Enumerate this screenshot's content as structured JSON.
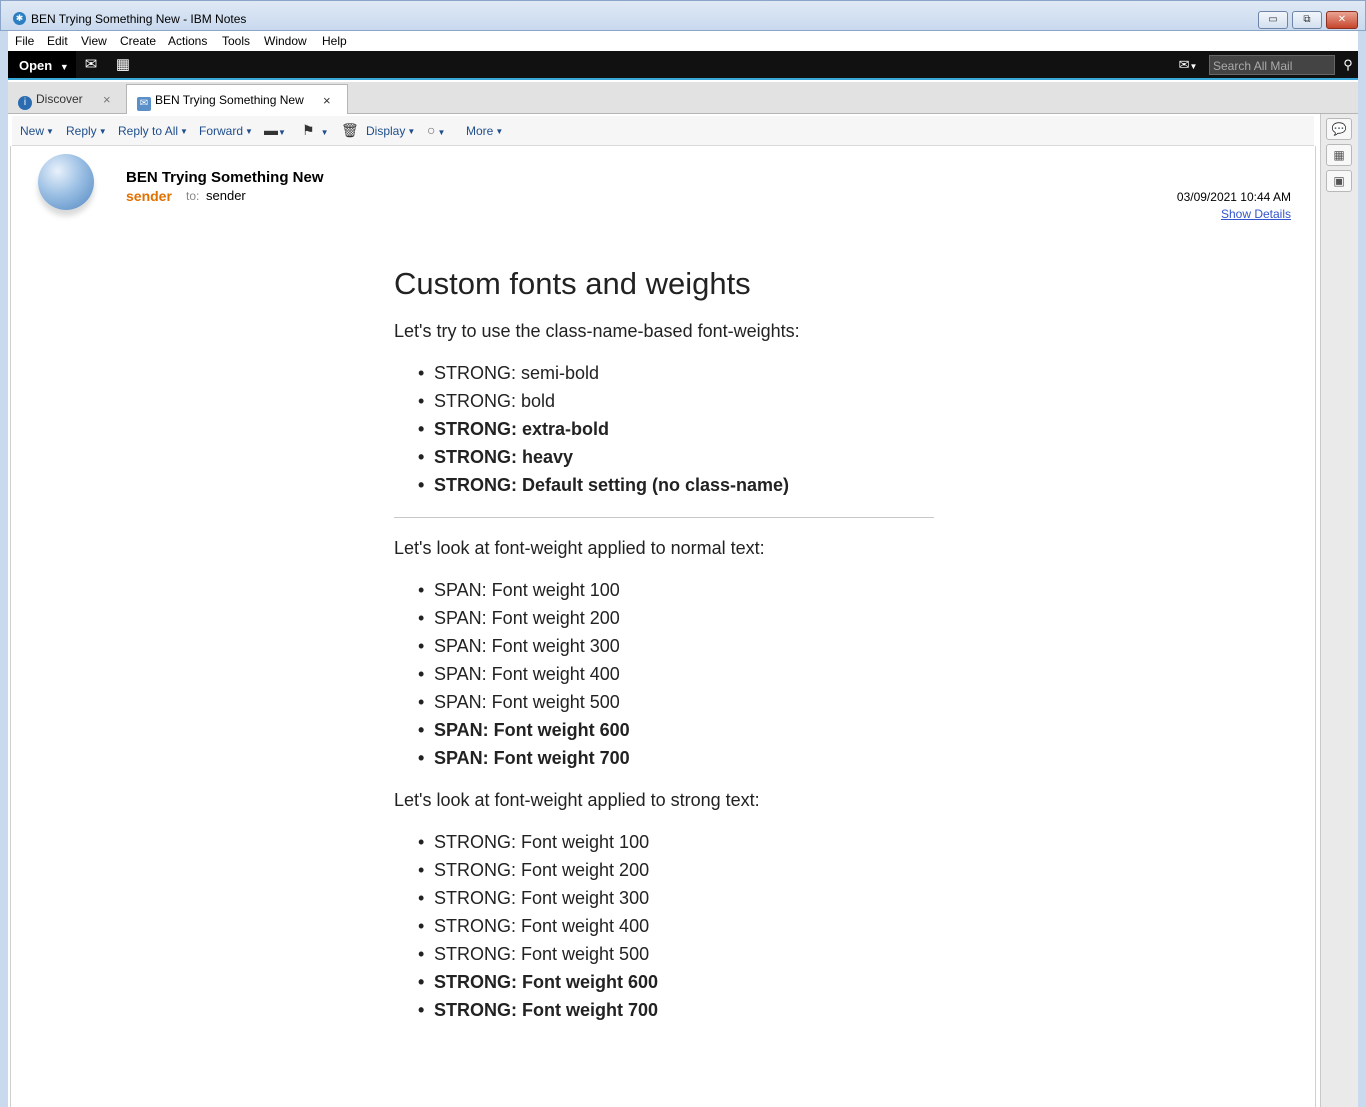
{
  "window": {
    "title": "BEN Trying Something New - IBM Notes",
    "minimize": "▭",
    "restore": "⧉",
    "close": "✕"
  },
  "menu": [
    "File",
    "Edit",
    "View",
    "Create",
    "Actions",
    "Tools",
    "Window",
    "Help"
  ],
  "toolbar": {
    "open_label": "Open",
    "search_placeholder": "Search All Mail"
  },
  "tabs": [
    {
      "label": "Discover"
    },
    {
      "label": "BEN Trying Something New"
    }
  ],
  "actions": {
    "new": "New",
    "reply": "Reply",
    "reply_all": "Reply to All",
    "forward": "Forward",
    "display": "Display",
    "more": "More"
  },
  "header": {
    "subject": "BEN Trying Something New",
    "from": "sender",
    "to_label": "to:",
    "to": "sender",
    "date": "03/09/2021 10:44 AM",
    "show_details": "Show Details"
  },
  "body": {
    "heading": "Custom fonts and weights",
    "intro1": "Let's try to use the class-name-based font-weights:",
    "list1": [
      "STRONG: semi-bold",
      "STRONG: bold",
      "STRONG: extra-bold",
      "STRONG: heavy",
      "STRONG: Default setting (no class-name)"
    ],
    "intro2": "Let's look at font-weight applied to normal text:",
    "list2": [
      "SPAN: Font weight 100",
      "SPAN: Font weight 200",
      "SPAN: Font weight 300",
      "SPAN: Font weight 400",
      "SPAN: Font weight 500",
      "SPAN: Font weight 600",
      "SPAN: Font weight 700"
    ],
    "intro3": "Let's look at font-weight applied to strong text:",
    "list3": [
      "STRONG: Font weight 100",
      "STRONG: Font weight 200",
      "STRONG: Font weight 300",
      "STRONG: Font weight 400",
      "STRONG: Font weight 500",
      "STRONG: Font weight 600",
      "STRONG: Font weight 700"
    ]
  }
}
